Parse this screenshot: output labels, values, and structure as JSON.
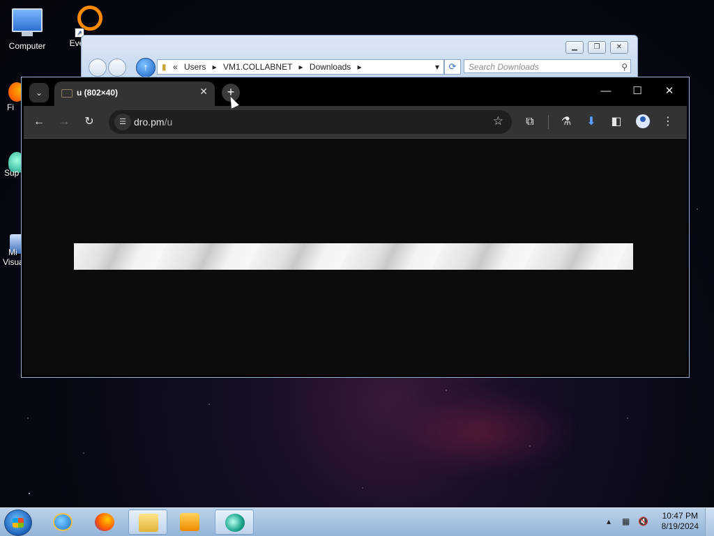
{
  "desktop": {
    "icons": [
      {
        "label": "Computer"
      },
      {
        "label": "Every"
      },
      {
        "label": "Fi"
      },
      {
        "label": "Sup"
      },
      {
        "label": "Mi"
      },
      {
        "label": "Visua"
      }
    ]
  },
  "explorer": {
    "breadcrumb": [
      "Users",
      "VM1.COLLABNET",
      "Downloads"
    ],
    "search_placeholder": "Search Downloads"
  },
  "chrome": {
    "tab_title": "u (802×40)",
    "url_host": "dro.pm",
    "url_path": "/u",
    "loader_width_px_label": "802×40"
  },
  "taskbar": {
    "time": "10:47 PM",
    "date": "8/19/2024"
  },
  "colors": {
    "chrome_toolbar": "#333333",
    "chrome_content": "#0c0c0c",
    "taskbar": "#a9c3e2"
  }
}
